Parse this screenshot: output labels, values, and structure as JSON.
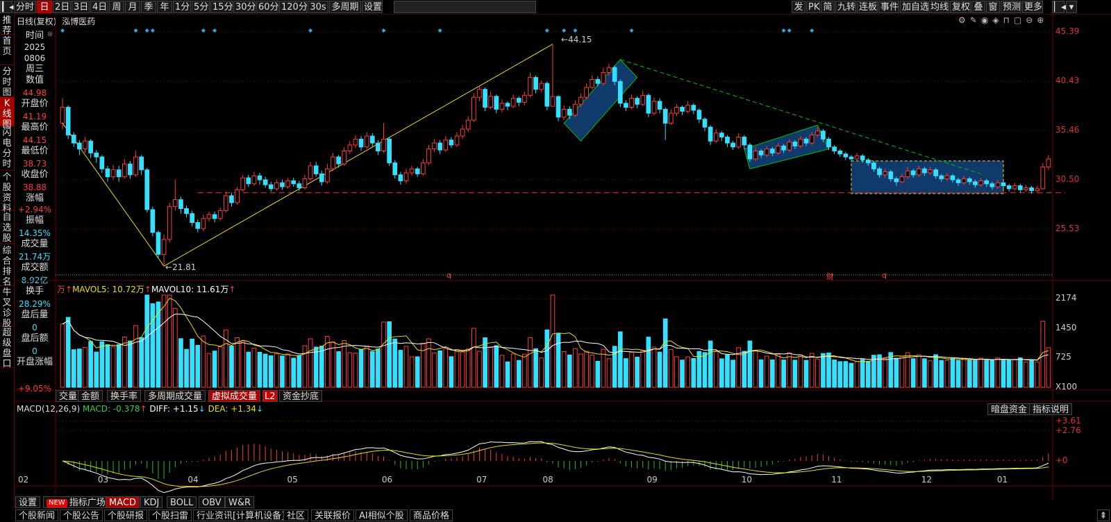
{
  "toolbar_left": [
    {
      "label": "分时",
      "active": false
    },
    {
      "label": "日",
      "active": true
    },
    {
      "label": "2日",
      "active": false
    },
    {
      "label": "3日",
      "active": false
    },
    {
      "label": "4日",
      "active": false
    },
    {
      "label": "周",
      "active": false
    },
    {
      "label": "月",
      "active": false
    },
    {
      "label": "季",
      "active": false
    },
    {
      "label": "年",
      "active": false
    },
    {
      "label": "1分",
      "active": false
    },
    {
      "label": "5分",
      "active": false
    },
    {
      "label": "15分",
      "active": false
    },
    {
      "label": "30分",
      "active": false
    },
    {
      "label": "60分",
      "active": false
    },
    {
      "label": "120分",
      "active": false
    },
    {
      "label": "30s",
      "active": false
    },
    {
      "label": "多周期",
      "active": false
    },
    {
      "label": "设置",
      "active": false
    }
  ],
  "toolbar_right": [
    "发",
    "PK",
    "简",
    "九转",
    "连板",
    "事件",
    "加自选",
    "均线",
    "复权",
    "叠",
    "窗",
    "预测",
    "更多"
  ],
  "left_nav": [
    "推荐",
    "首页",
    "分时图",
    "K线图",
    "闪电分时",
    "个股资料",
    "自选股",
    "综合排名",
    "牛叉诊股",
    "超级盘口"
  ],
  "left_nav_active": "K线图",
  "chart_header": {
    "period": "日线(复权)",
    "stock": "泓博医药"
  },
  "info_panel": {
    "time_label": "时间",
    "year": "2025",
    "date": "0806",
    "weekday": "周三",
    "value_label": "数值",
    "value": "44.98",
    "open_label": "开盘价",
    "open": "41.19",
    "high_label": "最高价",
    "high": "44.15",
    "low_label": "最低价",
    "low": "38.73",
    "close_label": "收盘价",
    "close": "38.88",
    "change_label": "涨幅",
    "change": "+2.94%",
    "amplitude_label": "振幅",
    "amplitude": "14.35%",
    "volume_label": "成交量",
    "volume": "21.74万",
    "turnover_label": "成交额",
    "turnover": "8.92亿",
    "handover_label": "换手",
    "handover": "28.29%",
    "after_vol_label": "盘后量",
    "after_vol": "0",
    "after_amt_label": "盘后额",
    "after_amt": "0",
    "open_change_label": "开盘涨幅",
    "open_change": "+9.05%"
  },
  "price_axis": [
    "45.39",
    "40.43",
    "35.46",
    "30.50",
    "25.53"
  ],
  "price_annotations": {
    "high": "44.15",
    "low": "21.81"
  },
  "volume_header": {
    "unit": "万",
    "mavol5_label": "MAVOL5:",
    "mavol5": "10.72万",
    "mavol10_label": "MAVOL10:",
    "mavol10": "11.61万"
  },
  "volume_axis": [
    "2174",
    "1450",
    "725",
    "X100"
  ],
  "volume_tabs": [
    "交量",
    "金额",
    "换手率",
    "多周期成交量",
    "虚拟成交量",
    "L2",
    "资金抄底"
  ],
  "volume_tab_active": "虚拟成交量",
  "macd_header": {
    "name": "MACD(12,26,9)",
    "macd_label": "MACD:",
    "macd": "-0.378",
    "diff_label": "DIFF:",
    "diff": "+1.15",
    "dea_label": "DEA:",
    "dea": "+1.34"
  },
  "macd_axis": [
    "+3.61",
    "+2.76",
    "+0"
  ],
  "macd_buttons": [
    "暗盘资金",
    "指标说明"
  ],
  "x_axis": [
    "02",
    "03",
    "04",
    "05",
    "06",
    "07",
    "08",
    "09",
    "10",
    "11",
    "12",
    "01"
  ],
  "event_markers": [
    "q",
    "财",
    "q"
  ],
  "indicator_tabs": [
    {
      "label": "设置",
      "new": false
    },
    {
      "label": "指标广场",
      "new": true,
      "badge": "NEW"
    },
    {
      "label": "MACD",
      "new": false
    },
    {
      "label": "KDJ",
      "new": false
    },
    {
      "label": "BOLL",
      "new": false
    },
    {
      "label": "OBV",
      "new": false
    },
    {
      "label": "W&R",
      "new": false
    }
  ],
  "indicator_active": "MACD",
  "bottom_tabs": [
    "个股新闻",
    "个股公告",
    "个股研报",
    "个股扫雷",
    "行业资讯[计算机设备]",
    "社区",
    "关联报价",
    "AI相似个股",
    "商品价格"
  ],
  "colors": {
    "up": "#ff3c3c",
    "down": "#35e0ff",
    "ma5": "#e8e000",
    "ma10": "#ffffff",
    "trend": "#e8e000",
    "resist": "#00c000",
    "support": "#d02020",
    "box": "#103a6a"
  },
  "chart_data": {
    "type": "candlestick",
    "price_range": [
      21.5,
      45.39
    ],
    "candles": [
      [
        36.2,
        37.8,
        38.7,
        35.6
      ],
      [
        37.8,
        35.0,
        38.0,
        34.6
      ],
      [
        35.0,
        34.2,
        35.3,
        33.8
      ],
      [
        34.2,
        33.6,
        34.5,
        33.0
      ],
      [
        33.6,
        34.4,
        34.8,
        33.2
      ],
      [
        34.4,
        33.2,
        34.6,
        32.7
      ],
      [
        33.2,
        32.8,
        33.5,
        32.2
      ],
      [
        32.8,
        31.6,
        33.0,
        31.2
      ],
      [
        31.6,
        30.8,
        31.9,
        30.3
      ],
      [
        30.8,
        31.5,
        32.0,
        30.5
      ],
      [
        31.5,
        30.8,
        31.9,
        30.3
      ],
      [
        30.8,
        32.1,
        32.6,
        30.6
      ],
      [
        32.1,
        31.0,
        32.4,
        30.6
      ],
      [
        31.0,
        32.8,
        33.4,
        30.8
      ],
      [
        32.8,
        31.5,
        33.0,
        31.0
      ],
      [
        31.5,
        27.5,
        31.7,
        27.2
      ],
      [
        27.5,
        25.2,
        27.8,
        24.8
      ],
      [
        25.2,
        23.0,
        25.4,
        22.6
      ],
      [
        23.0,
        24.5,
        25.0,
        21.81
      ],
      [
        24.5,
        27.8,
        28.2,
        24.2
      ],
      [
        27.8,
        28.5,
        30.5,
        27.4
      ],
      [
        28.5,
        27.6,
        28.8,
        27.1
      ],
      [
        27.6,
        27.1,
        27.9,
        26.7
      ],
      [
        27.1,
        26.2,
        27.4,
        25.8
      ],
      [
        26.2,
        25.6,
        26.5,
        25.2
      ],
      [
        25.6,
        26.6,
        27.0,
        25.3
      ],
      [
        26.6,
        27.0,
        27.3,
        26.3
      ],
      [
        27.0,
        26.6,
        27.3,
        26.2
      ],
      [
        26.6,
        27.4,
        27.7,
        26.4
      ],
      [
        27.4,
        28.9,
        29.3,
        27.2
      ],
      [
        28.9,
        28.2,
        29.2,
        27.8
      ],
      [
        28.2,
        29.5,
        29.8,
        28.0
      ],
      [
        29.5,
        30.7,
        31.0,
        29.3
      ],
      [
        30.7,
        30.1,
        31.0,
        29.8
      ],
      [
        30.1,
        30.9,
        31.3,
        29.9
      ],
      [
        30.9,
        30.5,
        31.2,
        30.0
      ],
      [
        30.5,
        30.0,
        30.8,
        29.7
      ],
      [
        30.0,
        29.6,
        30.3,
        29.3
      ],
      [
        29.6,
        30.2,
        30.5,
        29.4
      ],
      [
        30.2,
        29.8,
        30.5,
        29.5
      ],
      [
        29.8,
        30.4,
        30.7,
        29.6
      ],
      [
        30.4,
        30.1,
        30.7,
        29.8
      ],
      [
        30.1,
        29.7,
        30.4,
        29.4
      ],
      [
        29.7,
        30.6,
        31.0,
        29.5
      ],
      [
        30.6,
        31.9,
        32.3,
        30.4
      ],
      [
        31.9,
        31.1,
        32.3,
        30.8
      ],
      [
        31.1,
        30.3,
        31.4,
        29.9
      ],
      [
        30.3,
        31.6,
        32.1,
        30.1
      ],
      [
        31.6,
        32.8,
        33.2,
        31.4
      ],
      [
        32.8,
        32.1,
        33.0,
        31.7
      ],
      [
        32.1,
        33.4,
        33.8,
        31.9
      ],
      [
        33.4,
        34.0,
        34.4,
        33.1
      ],
      [
        34.0,
        34.6,
        35.0,
        33.7
      ],
      [
        34.6,
        33.8,
        34.9,
        33.4
      ],
      [
        33.8,
        34.9,
        35.3,
        33.6
      ],
      [
        34.9,
        34.2,
        35.2,
        33.8
      ],
      [
        34.2,
        33.4,
        34.5,
        33.0
      ],
      [
        33.4,
        34.6,
        36.2,
        33.2
      ],
      [
        34.6,
        32.2,
        34.8,
        31.9
      ],
      [
        32.2,
        31.0,
        32.5,
        30.6
      ],
      [
        31.0,
        30.4,
        31.3,
        30.0
      ],
      [
        30.4,
        31.2,
        31.6,
        30.1
      ],
      [
        31.2,
        31.6,
        31.9,
        30.9
      ],
      [
        31.6,
        31.1,
        31.8,
        30.8
      ],
      [
        31.1,
        32.2,
        32.6,
        30.9
      ],
      [
        32.2,
        33.6,
        34.0,
        32.0
      ],
      [
        33.6,
        34.2,
        34.6,
        33.3
      ],
      [
        34.2,
        33.5,
        34.5,
        33.1
      ],
      [
        33.5,
        34.5,
        34.9,
        33.3
      ],
      [
        34.5,
        34.0,
        34.8,
        33.7
      ],
      [
        34.0,
        34.9,
        35.3,
        33.8
      ],
      [
        34.9,
        35.6,
        36.0,
        34.6
      ],
      [
        35.6,
        36.5,
        36.9,
        35.3
      ],
      [
        36.5,
        38.8,
        39.2,
        36.3
      ],
      [
        38.8,
        39.6,
        40.0,
        38.4
      ],
      [
        39.6,
        37.8,
        39.8,
        37.4
      ],
      [
        37.8,
        38.9,
        39.4,
        37.6
      ],
      [
        38.9,
        37.6,
        39.1,
        37.2
      ],
      [
        37.6,
        38.2,
        38.6,
        37.3
      ],
      [
        38.2,
        37.9,
        38.4,
        37.5
      ],
      [
        37.9,
        38.7,
        39.1,
        37.7
      ],
      [
        38.7,
        38.3,
        38.9,
        37.9
      ],
      [
        38.3,
        39.0,
        39.4,
        38.0
      ],
      [
        39.0,
        40.8,
        41.3,
        38.8
      ],
      [
        40.8,
        39.6,
        41.0,
        39.2
      ],
      [
        39.6,
        40.2,
        40.5,
        39.3
      ],
      [
        40.2,
        37.9,
        40.4,
        37.5
      ],
      [
        37.9,
        38.88,
        44.15,
        38.73
      ],
      [
        38.88,
        36.8,
        39.0,
        36.4
      ],
      [
        36.8,
        37.6,
        38.0,
        36.5
      ],
      [
        37.6,
        37.0,
        37.9,
        36.6
      ],
      [
        37.0,
        38.1,
        38.5,
        36.8
      ],
      [
        38.1,
        38.8,
        39.2,
        37.8
      ],
      [
        38.8,
        39.8,
        40.2,
        38.6
      ],
      [
        39.8,
        40.6,
        41.0,
        39.6
      ],
      [
        40.6,
        40.2,
        40.9,
        39.9
      ],
      [
        40.2,
        41.3,
        41.8,
        40.0
      ],
      [
        41.3,
        41.8,
        42.2,
        41.0
      ],
      [
        41.8,
        40.4,
        42.0,
        40.0
      ],
      [
        40.4,
        38.2,
        40.6,
        37.8
      ],
      [
        38.2,
        37.8,
        38.5,
        37.4
      ],
      [
        37.8,
        38.7,
        39.1,
        37.6
      ],
      [
        38.7,
        38.1,
        38.9,
        37.7
      ],
      [
        38.1,
        39.0,
        39.5,
        37.9
      ],
      [
        39.0,
        37.2,
        39.2,
        36.8
      ],
      [
        37.2,
        38.4,
        38.8,
        37.0
      ],
      [
        38.4,
        37.6,
        38.7,
        37.2
      ],
      [
        37.6,
        36.2,
        37.8,
        34.5
      ],
      [
        36.2,
        37.2,
        37.6,
        36.0
      ],
      [
        37.2,
        37.8,
        38.1,
        36.9
      ],
      [
        37.8,
        37.4,
        38.0,
        37.0
      ],
      [
        37.4,
        38.0,
        38.4,
        37.2
      ],
      [
        38.0,
        37.5,
        38.2,
        37.1
      ],
      [
        37.5,
        36.6,
        37.7,
        36.2
      ],
      [
        36.6,
        35.8,
        36.8,
        35.4
      ],
      [
        35.8,
        34.4,
        36.0,
        34.0
      ],
      [
        34.4,
        35.2,
        35.6,
        34.2
      ],
      [
        35.2,
        34.8,
        35.4,
        34.4
      ],
      [
        34.8,
        34.2,
        35.0,
        33.8
      ],
      [
        34.2,
        33.8,
        34.4,
        33.5
      ],
      [
        33.8,
        34.8,
        35.2,
        33.6
      ],
      [
        34.8,
        34.0,
        35.0,
        33.6
      ],
      [
        34.0,
        32.6,
        34.2,
        32.3
      ],
      [
        32.6,
        33.4,
        33.8,
        32.4
      ],
      [
        33.4,
        33.0,
        33.6,
        32.7
      ],
      [
        33.0,
        33.6,
        33.9,
        32.8
      ],
      [
        33.6,
        33.2,
        33.8,
        32.9
      ],
      [
        33.2,
        33.9,
        34.2,
        33.0
      ],
      [
        33.9,
        33.5,
        34.1,
        33.2
      ],
      [
        33.5,
        34.3,
        34.6,
        33.3
      ],
      [
        34.3,
        33.9,
        34.5,
        33.6
      ],
      [
        33.9,
        34.6,
        34.9,
        33.7
      ],
      [
        34.6,
        34.2,
        34.8,
        33.9
      ],
      [
        34.2,
        35.0,
        35.3,
        34.0
      ],
      [
        35.0,
        35.4,
        35.8,
        34.8
      ],
      [
        35.4,
        34.6,
        35.6,
        34.3
      ],
      [
        34.6,
        33.8,
        34.8,
        33.5
      ],
      [
        33.8,
        33.4,
        34.0,
        33.1
      ],
      [
        33.4,
        33.1,
        33.6,
        32.8
      ],
      [
        33.1,
        32.8,
        33.3,
        32.5
      ],
      [
        32.8,
        32.6,
        33.0,
        32.3
      ],
      [
        32.6,
        32.9,
        33.2,
        32.4
      ],
      [
        32.9,
        32.5,
        33.1,
        32.2
      ],
      [
        32.5,
        32.2,
        32.7,
        31.9
      ],
      [
        32.2,
        31.6,
        32.4,
        31.3
      ],
      [
        31.6,
        31.0,
        31.8,
        30.7
      ],
      [
        31.0,
        31.3,
        31.6,
        30.7
      ],
      [
        31.3,
        30.6,
        31.5,
        30.3
      ],
      [
        30.6,
        30.3,
        30.8,
        29.9
      ],
      [
        30.3,
        30.8,
        31.1,
        30.1
      ],
      [
        30.8,
        31.4,
        31.8,
        30.6
      ],
      [
        31.4,
        31.0,
        31.6,
        30.7
      ],
      [
        31.0,
        31.6,
        31.9,
        30.8
      ],
      [
        31.6,
        31.2,
        31.8,
        30.9
      ],
      [
        31.2,
        31.5,
        31.8,
        31.0
      ],
      [
        31.5,
        30.9,
        31.7,
        30.6
      ],
      [
        30.9,
        30.6,
        31.1,
        30.3
      ],
      [
        30.6,
        30.9,
        31.2,
        30.4
      ],
      [
        30.9,
        30.5,
        31.1,
        30.2
      ],
      [
        30.5,
        30.2,
        30.7,
        29.9
      ],
      [
        30.2,
        30.6,
        30.9,
        30.0
      ],
      [
        30.6,
        30.3,
        30.8,
        30.0
      ],
      [
        30.3,
        30.0,
        30.5,
        29.7
      ],
      [
        30.0,
        30.4,
        30.7,
        29.8
      ],
      [
        30.4,
        30.1,
        30.6,
        29.8
      ],
      [
        30.1,
        29.8,
        30.3,
        29.5
      ],
      [
        29.8,
        30.2,
        30.5,
        29.6
      ],
      [
        30.2,
        29.9,
        30.4,
        29.6
      ],
      [
        29.9,
        29.6,
        30.1,
        29.3
      ],
      [
        29.6,
        29.9,
        30.2,
        29.4
      ],
      [
        29.9,
        29.5,
        30.1,
        29.2
      ],
      [
        29.5,
        29.7,
        30.0,
        29.3
      ],
      [
        29.7,
        29.4,
        29.9,
        29.1
      ],
      [
        29.4,
        29.6,
        29.9,
        29.2
      ],
      [
        29.6,
        31.8,
        32.2,
        29.5
      ],
      [
        31.8,
        32.6,
        33.0,
        31.5
      ]
    ]
  }
}
